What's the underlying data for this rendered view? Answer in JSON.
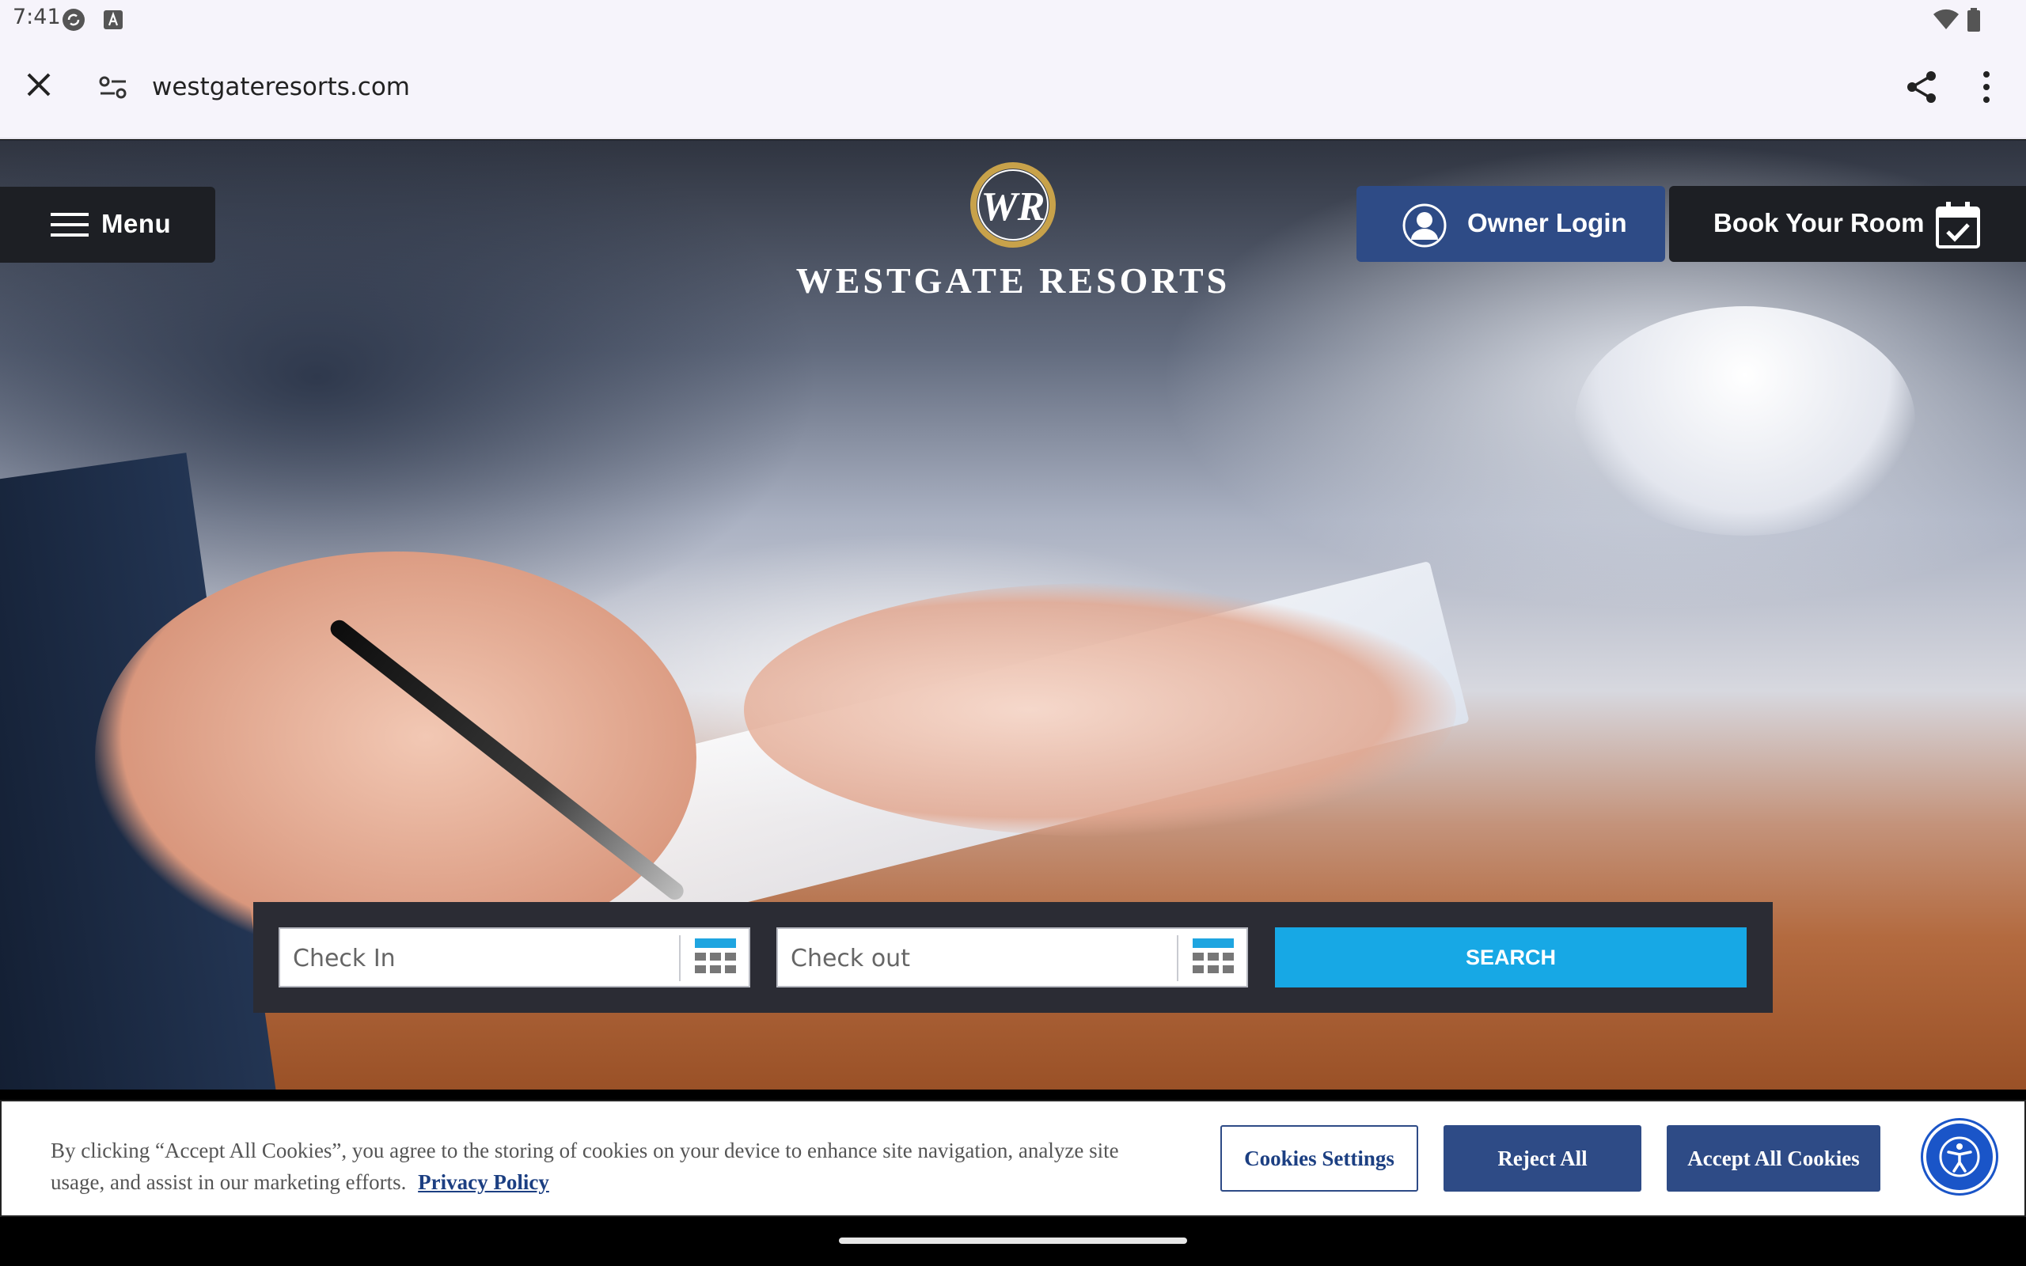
{
  "status_bar": {
    "time": "7:41",
    "icons": [
      "sync-icon",
      "font-a-icon",
      "wifi-icon",
      "battery-icon"
    ]
  },
  "browser": {
    "url": "westgateresorts.com",
    "icons": [
      "close-icon",
      "site-settings-icon",
      "share-icon",
      "more-vert-icon"
    ]
  },
  "header": {
    "menu_label": "Menu",
    "brand_name": "WESTGATE RESORTS",
    "owner_login_label": "Owner Login",
    "book_room_label": "Book Your Room"
  },
  "booking": {
    "check_in_placeholder": "Check In",
    "check_out_placeholder": "Check out",
    "search_label": "SEARCH"
  },
  "cookie_banner": {
    "message": "By clicking “Accept All Cookies”, you agree to the storing of cookies on your device to enhance site navigation, analyze site usage, and assist in our marketing efforts.",
    "privacy_link": "Privacy Policy",
    "settings_label": "Cookies Settings",
    "reject_label": "Reject All",
    "accept_label": "Accept All Cookies"
  },
  "colors": {
    "primary_blue": "#2e4b86",
    "search_blue": "#17a8e5",
    "dark_button": "#1d1f24",
    "accessibility_blue": "#1a55c8"
  }
}
